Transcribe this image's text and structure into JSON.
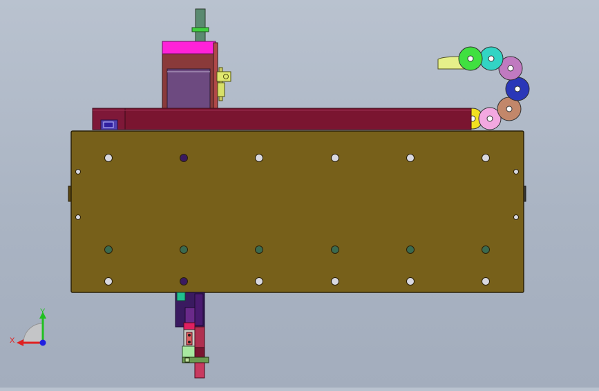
{
  "viewport": {
    "background_top": "#b9c2cf",
    "background_bottom": "#a3adbd"
  },
  "model": {
    "plate_color": "#77601a",
    "rail_color": "#7a1530",
    "motor_cap_color": "#ff22d8",
    "carriage_color": "#8a3a3a",
    "screen_color": "#6d4a80",
    "chain_link_colors": [
      "#f2e020",
      "#f3a8e0",
      "#c2876a",
      "#2a37b8",
      "#c07ac0",
      "#32d4c4",
      "#40e040",
      "#e8f080"
    ]
  },
  "triad": {
    "x_label": "X",
    "y_label": "Y",
    "x_color": "#e02020",
    "y_color": "#20c020",
    "z_color": "#2020e0"
  }
}
